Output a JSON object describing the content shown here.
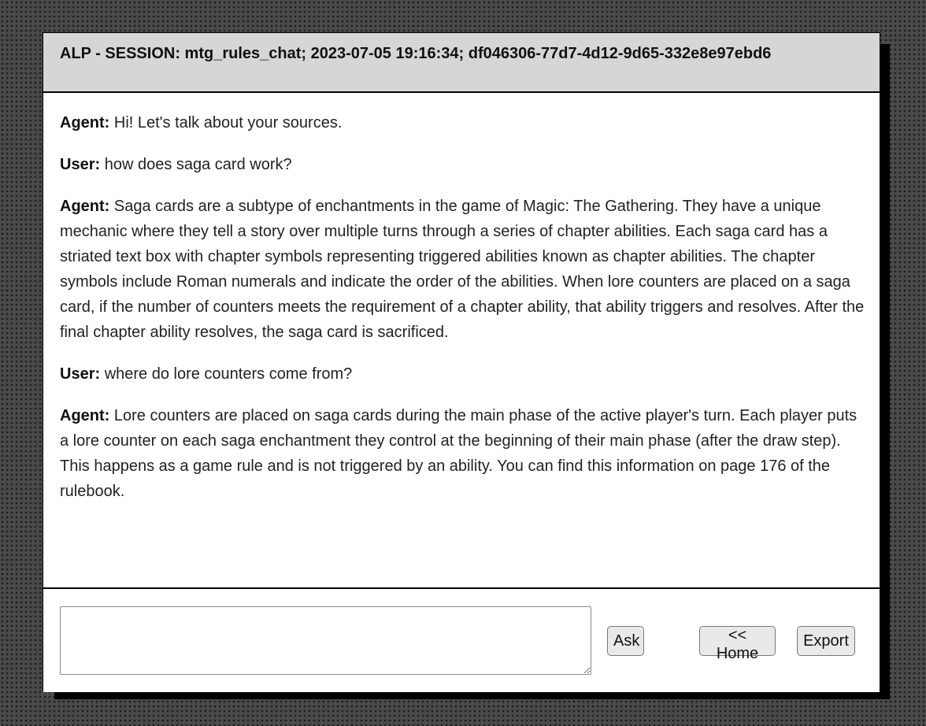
{
  "header": {
    "title": "ALP - SESSION: mtg_rules_chat; 2023-07-05 19:16:34; df046306-77d7-4d12-9d65-332e8e97ebd6"
  },
  "messages": [
    {
      "speaker": "Agent:",
      "text": " Hi! Let's talk about your sources."
    },
    {
      "speaker": "User:",
      "text": " how does saga card work?"
    },
    {
      "speaker": "Agent:",
      "text": " Saga cards are a subtype of enchantments in the game of Magic: The Gathering. They have a unique mechanic where they tell a story over multiple turns through a series of chapter abilities. Each saga card has a striated text box with chapter symbols representing triggered abilities known as chapter abilities. The chapter symbols include Roman numerals and indicate the order of the abilities. When lore counters are placed on a saga card, if the number of counters meets the requirement of a chapter ability, that ability triggers and resolves. After the final chapter ability resolves, the saga card is sacrificed."
    },
    {
      "speaker": "User:",
      "text": " where do lore counters come from?"
    },
    {
      "speaker": "Agent:",
      "text": " Lore counters are placed on saga cards during the main phase of the active player's turn. Each player puts a lore counter on each saga enchantment they control at the beginning of their main phase (after the draw step). This happens as a game rule and is not triggered by an ability. You can find this information on page 176 of the rulebook."
    }
  ],
  "input": {
    "value": "",
    "placeholder": ""
  },
  "buttons": {
    "ask": "Ask",
    "home": "<< Home",
    "export": "Export"
  }
}
